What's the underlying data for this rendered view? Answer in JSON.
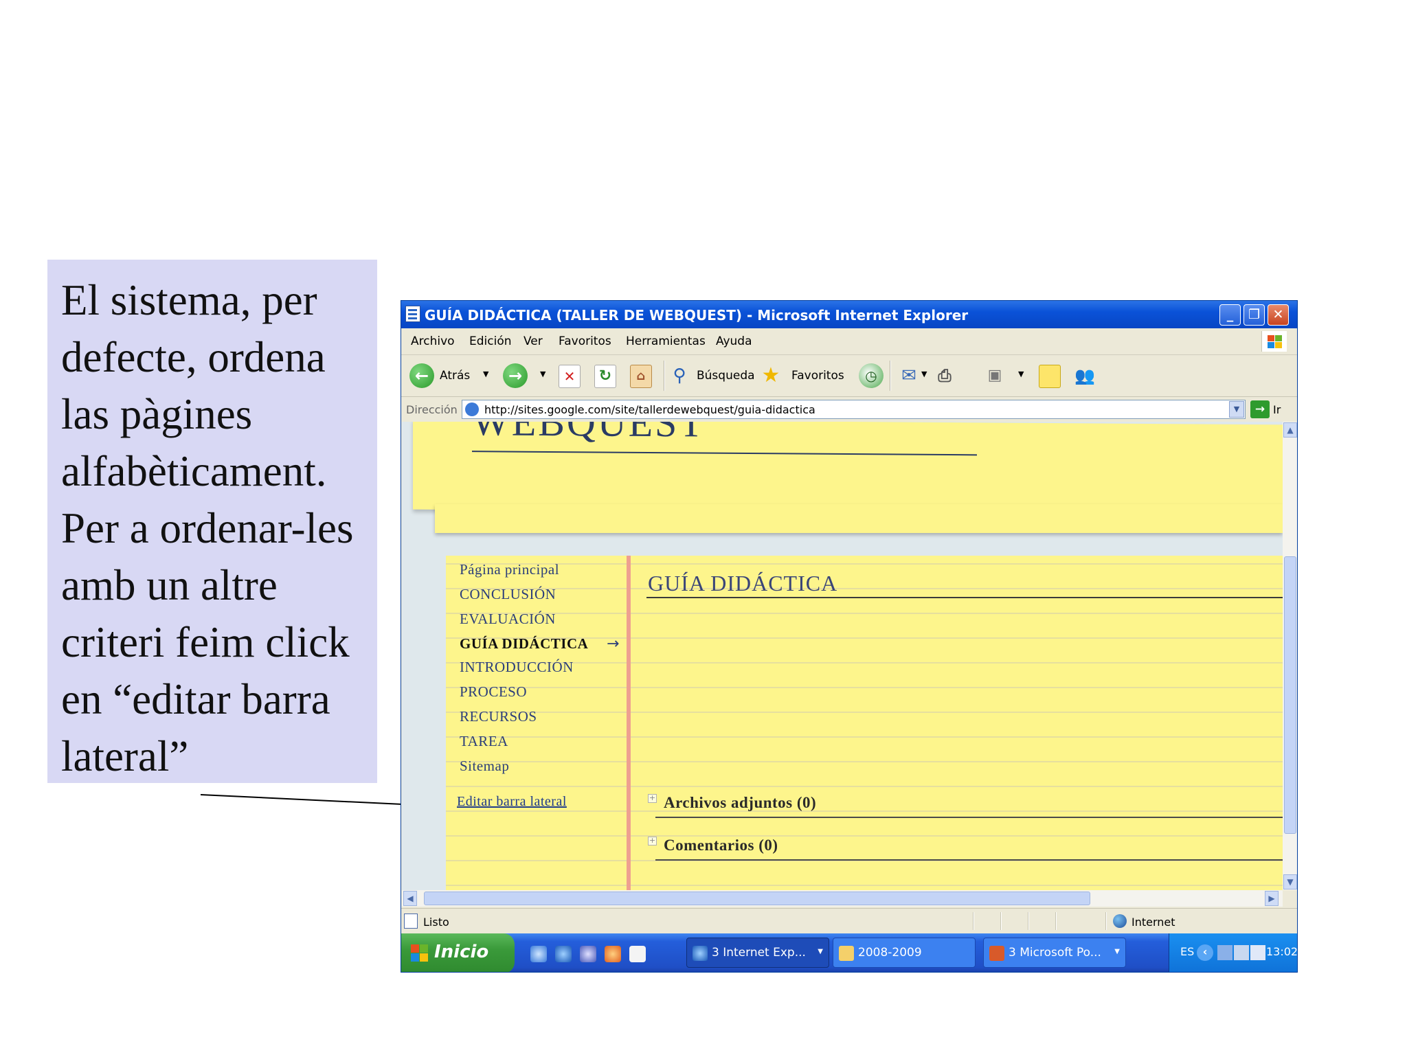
{
  "callout": {
    "text": "El sistema, per defecte, ordena las pàgines alfabèticament. Per a ordenar-les amb un altre criteri feim click en “editar barra lateral”"
  },
  "window": {
    "title": "GUÍA DIDÁCTICA (TALLER DE WEBQUEST) - Microsoft Internet Explorer",
    "buttons": {
      "minimize_icon": "minimize-icon",
      "maximize_icon": "restore-icon",
      "close_icon": "close-icon"
    }
  },
  "menu": {
    "items": [
      "Archivo",
      "Edición",
      "Ver",
      "Favoritos",
      "Herramientas",
      "Ayuda"
    ]
  },
  "toolbar": {
    "back_label": "Atrás",
    "search_label": "Búsqueda",
    "favorites_label": "Favoritos"
  },
  "address": {
    "label": "Dirección",
    "url": "http://sites.google.com/site/tallerdewebquest/guia-didactica",
    "go_label": "Ir"
  },
  "site": {
    "banner_title": "WEBQUEST",
    "sidebar": [
      {
        "label": "Página principal",
        "active": false
      },
      {
        "label": "CONCLUSIÓN",
        "active": false
      },
      {
        "label": "EVALUACIÓN",
        "active": false
      },
      {
        "label": "GUÍA DIDÁCTICA",
        "active": true
      },
      {
        "label": "INTRODUCCIÓN",
        "active": false
      },
      {
        "label": "PROCESO",
        "active": false
      },
      {
        "label": "RECURSOS",
        "active": false
      },
      {
        "label": "TAREA",
        "active": false
      },
      {
        "label": "Sitemap",
        "active": false
      }
    ],
    "active_arrow": "→",
    "edit_sidebar_label": "Editar barra lateral",
    "page_title": "GUÍA DIDÁCTICA",
    "attachments_label": "Archivos adjuntos (0)",
    "comments_label": "Comentarios (0)"
  },
  "status": {
    "text": "Listo",
    "zone": "Internet"
  },
  "taskbar": {
    "start_label": "Inicio",
    "tasks": [
      {
        "label": "3 Internet Exp...",
        "active": true
      },
      {
        "label": "2008-2009",
        "active": false
      },
      {
        "label": "3 Microsoft Po...",
        "active": false
      }
    ],
    "lang": "ES",
    "time": "13:02"
  },
  "colors": {
    "callout_bg": "#d8d8f4",
    "title_bar": "#0a52d8",
    "paper": "#fdf58c",
    "link": "#2b3e7a",
    "taskbar": "#245edb",
    "start": "#3a9a3a"
  }
}
